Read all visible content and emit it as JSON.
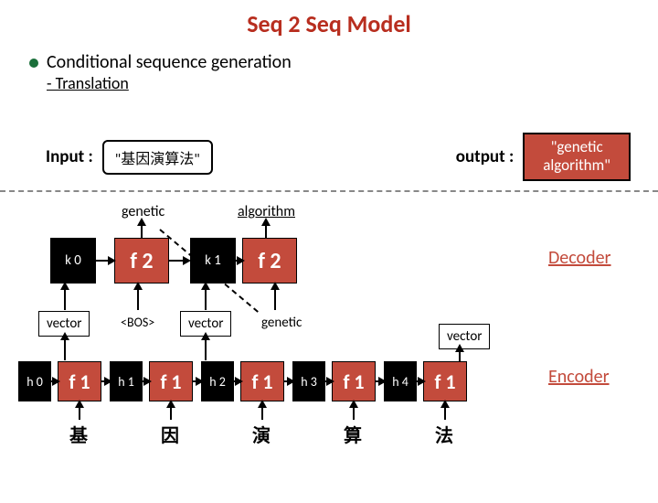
{
  "title": "Seq 2 Seq Model",
  "bullet": "Conditional sequence generation",
  "sub": "- Translation",
  "input_label": "Input :",
  "input_value": "\"基因演算法\"",
  "output_label": "output :",
  "output_line1": "\"genetic",
  "output_line2": "algorithm\"",
  "outwords": {
    "w1": "genetic",
    "w2": "algorithm"
  },
  "k": {
    "k0": "k 0",
    "k1": "k 1"
  },
  "f2": "f 2",
  "f1": "f 1",
  "bos": "<BOS>",
  "vector": "vector",
  "h": {
    "h0": "h 0",
    "h1": "h 1",
    "h2": "h 2",
    "h3": "h 3",
    "h4": "h 4"
  },
  "cjk": {
    "c1": "基",
    "c2": "因",
    "c3": "演",
    "c4": "算",
    "c5": "法"
  },
  "side": {
    "decoder": "Decoder",
    "encoder": "Encoder"
  }
}
